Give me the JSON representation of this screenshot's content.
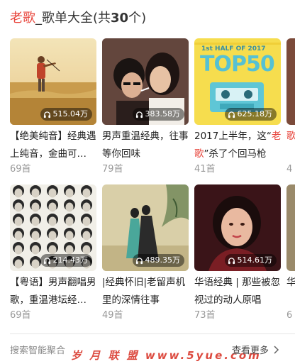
{
  "header": {
    "keyword": "老歌",
    "rest": "_歌单大全(共",
    "count": "30",
    "suffix": "个)"
  },
  "playlists": [
    {
      "plays": "515.04万",
      "title": "【绝美纯音】经典遇上纯音，金曲可…",
      "songs": "69首",
      "cover": "violin-field-cover"
    },
    {
      "plays": "383.58万",
      "title": "男声重温经典，往事等你回味",
      "songs": "79首",
      "cover": "retro-couple-cover"
    },
    {
      "plays": "625.18万",
      "title_pre": "2017上半年，这“",
      "title_hl": "老歌",
      "title_post": "”杀了个回马枪",
      "songs": "41首",
      "cover": "top50-cassette-cover",
      "badge_top": "1st HALF OF 2017",
      "badge_main": "TOP50"
    },
    {
      "plays": "214.43万",
      "title": "【粤语】男声翻唱男歌，重温港坛经…",
      "songs": "69首",
      "cover": "faces-grid-cover"
    },
    {
      "plays": "489.35万",
      "title": "|经典怀旧|老留声机里的深情往事",
      "songs": "49首",
      "cover": "couple-illustration-cover"
    },
    {
      "plays": "514.61万",
      "title": "华语经典 | 那些被忽视过的动人原唱",
      "songs": "73首",
      "cover": "singer-portrait-cover"
    }
  ],
  "partial": [
    {
      "title": "歌",
      "songs": "4"
    },
    {
      "title": "华语经典都",
      "songs": "6"
    }
  ],
  "footer": {
    "left": "搜索智能聚合",
    "right": "查看更多"
  },
  "watermark": "岁 月 联 盟   www.5yue.com"
}
